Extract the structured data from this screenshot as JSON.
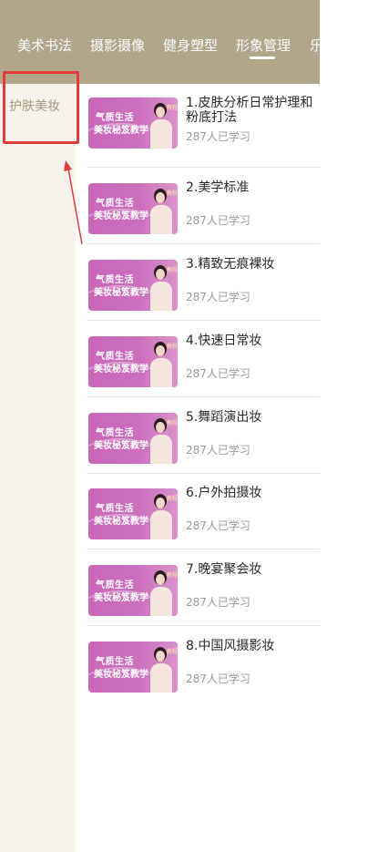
{
  "tabs": [
    {
      "label": "美术书法"
    },
    {
      "label": "摄影摄像"
    },
    {
      "label": "健身塑型"
    },
    {
      "label": "形象管理"
    },
    {
      "label": "乐"
    }
  ],
  "sidebar": {
    "items": [
      {
        "label": "护肤美妆"
      }
    ]
  },
  "thumbnail": {
    "line1": "气质生活",
    "line2": "美妆秘笈教学",
    "badge": "教程"
  },
  "courses": [
    {
      "title": "1.皮肤分析日常护理和粉底打法",
      "learners": "287人已学习"
    },
    {
      "title": "2.美学标准",
      "learners": "287人已学习"
    },
    {
      "title": "3.精致无痕裸妆",
      "learners": "287人已学习"
    },
    {
      "title": "4.快速日常妆",
      "learners": "287人已学习"
    },
    {
      "title": "5.舞蹈演出妆",
      "learners": "287人已学习"
    },
    {
      "title": "6.户外拍摄妆",
      "learners": "287人已学习"
    },
    {
      "title": "7.晚宴聚会妆",
      "learners": "287人已学习"
    },
    {
      "title": "8.中国风摄影妆",
      "learners": "287人已学习"
    }
  ],
  "colors": {
    "header": "#b1a58a",
    "sidebar": "#f4f2eb",
    "accent_text": "#a79a78",
    "annotation": "#e43a3a",
    "thumbnail": "#c967b8"
  }
}
